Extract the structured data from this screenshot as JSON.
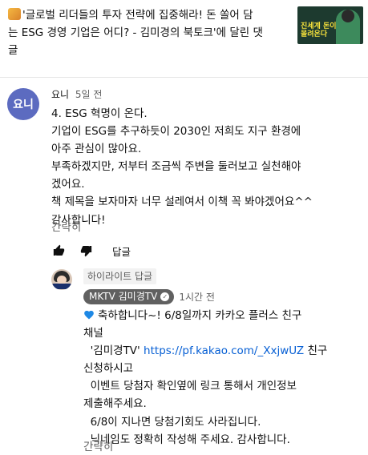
{
  "header": {
    "title_line1": "'글로벌 리더들의 투자 전략에 집중해라! 돈 쏠어 담",
    "title_line2": "는 ESG 경영 기업은 어디? - 김미경의 북토크'에 달린 댓",
    "title_line3": "글",
    "thumbnail_text": "진세계 돈이 몰려온다"
  },
  "comment": {
    "avatar_text": "요니",
    "author": "요니",
    "timestamp": "5일 전",
    "lines": [
      "4. ESG 혁명이 온다.",
      "기업이  ESG를 추구하듯이 2030인 저희도 지구 환경에",
      "아주 관심이 많아요.",
      "부족하겠지만, 저부터 조금씩 주변을 둘러보고 실천해야",
      "겠어요.",
      "책 제목을 보자마자 너무 설레여서 이책 꼭 봐야겠어요^^",
      "감사합니다!"
    ],
    "read_less": "간략히",
    "reply_label": "답글"
  },
  "reply": {
    "highlight_label": "하이라이트 답글",
    "author": "MKTV 김미경TV",
    "timestamp": "1시간 전",
    "line1": "축하합니다~! 6/8일까지 카카오 플러스 친구",
    "line2": "채널",
    "line3_prefix": "  '김미경TV' ",
    "line3_link": "https://pf.kakao.com/_XxjwUZ",
    "line3_suffix": " 친구",
    "line4": "신청하시고",
    "line5": "  이벤트 당첨자 확인옆에 링크 통해서 개인정보",
    "line6": "제출해주세요.",
    "line7": "  6/8이 지나면 당첨기회도 사라집니다.",
    "line8": "  닉네임도 정확히 작성해 주세요. 감사합니다.",
    "read_less": "간략히"
  },
  "colors": {
    "link": "#065fd4",
    "secondary_text": "#606060",
    "avatar_bg": "#5c6bc0",
    "heart": "#1e88e5"
  }
}
